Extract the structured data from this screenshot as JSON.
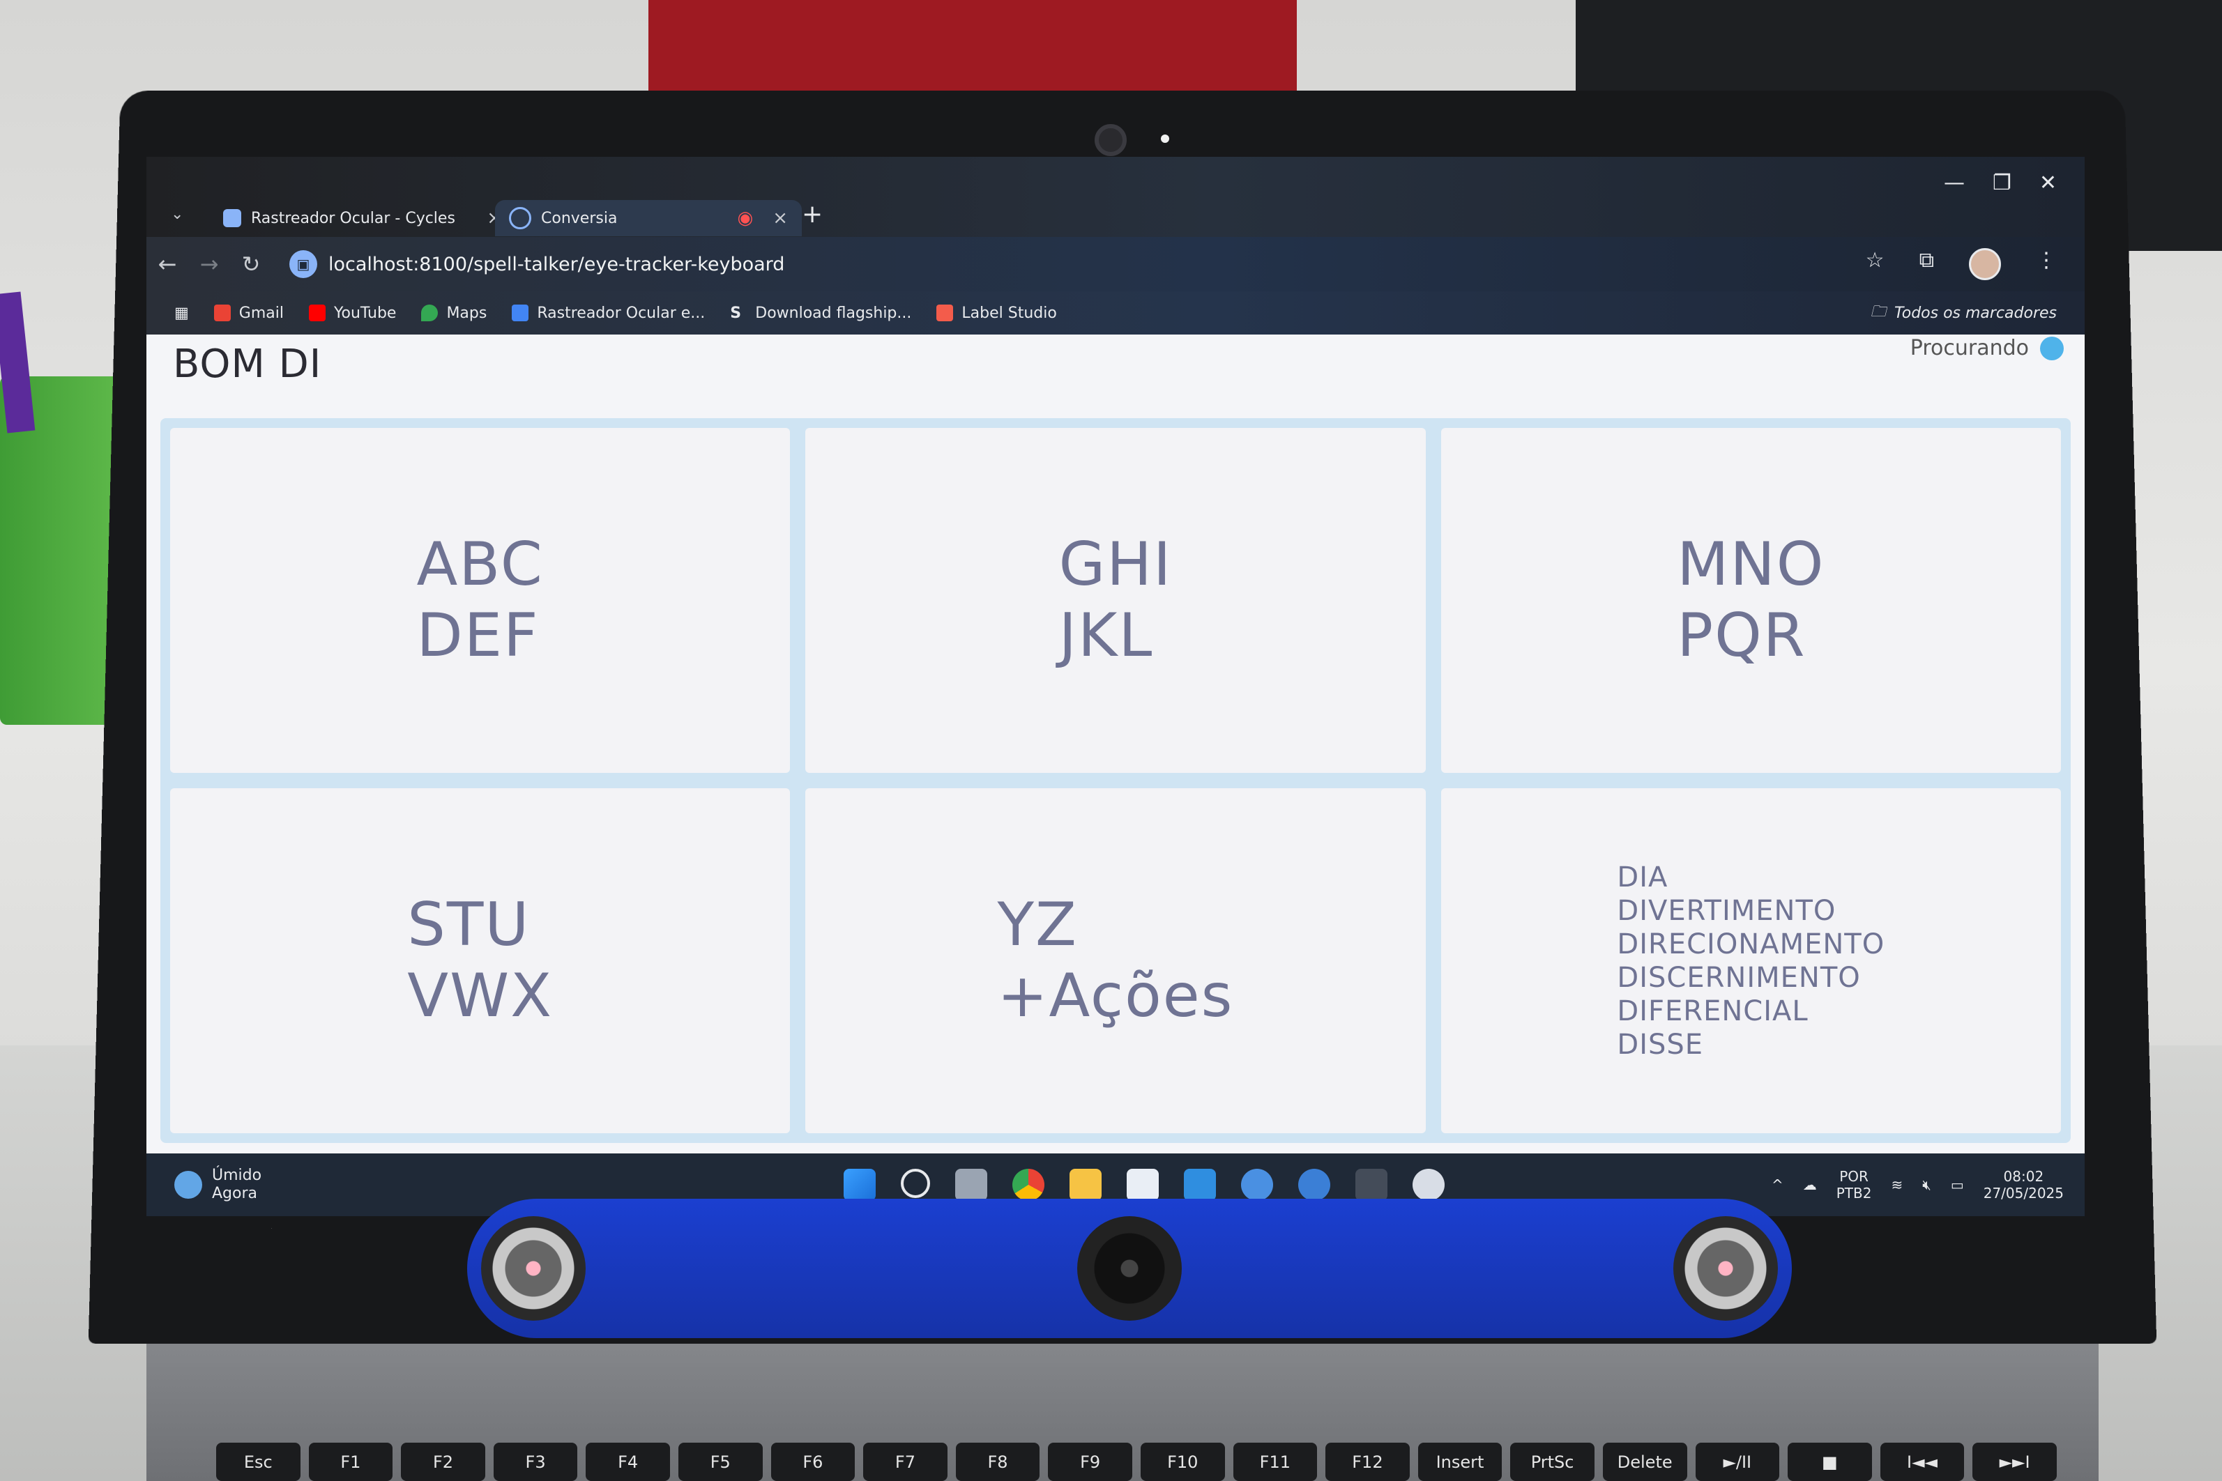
{
  "browser": {
    "tabs": [
      {
        "label": "Rastreador Ocular - Cycles",
        "active": false
      },
      {
        "label": "Conversia",
        "active": true
      }
    ],
    "url": "localhost:8100/spell-talker/eye-tracker-keyboard",
    "bookmarks": [
      "Gmail",
      "YouTube",
      "Maps",
      "Rastreador Ocular e...",
      "Download flagship...",
      "Label Studio"
    ],
    "all_bookmarks_label": "Todos os marcadores"
  },
  "app": {
    "typed_text": "BOM DI",
    "status_label": "Procurando",
    "status_color": "#4fb3ea",
    "cells": [
      {
        "lines": [
          "ABC",
          "DEF"
        ]
      },
      {
        "lines": [
          "GHI",
          "JKL"
        ]
      },
      {
        "lines": [
          "MNO",
          "PQR"
        ]
      },
      {
        "lines": [
          "STU",
          "VWX"
        ]
      },
      {
        "lines": [
          "YZ",
          "+Ações"
        ]
      },
      {
        "lines": [
          "DIA",
          "DIVERTIMENTO",
          "DIRECIONAMENTO",
          "DISCERNIMENTO",
          "DIFERENCIAL",
          "DISSE"
        ]
      }
    ]
  },
  "taskbar": {
    "weather_label": "Úmido",
    "weather_sub": "Agora",
    "lang_top": "POR",
    "lang_bottom": "PTB2",
    "time": "08:02",
    "date": "27/05/2025"
  },
  "keyboard": {
    "keys": [
      "Esc",
      "F1",
      "F2",
      "F3",
      "F4",
      "F5",
      "F6",
      "F7",
      "F8",
      "F9",
      "F10",
      "F11",
      "F12",
      "Insert",
      "PrtSc",
      "Delete",
      "►/II",
      "■",
      "I◄◄",
      "►►I"
    ]
  }
}
